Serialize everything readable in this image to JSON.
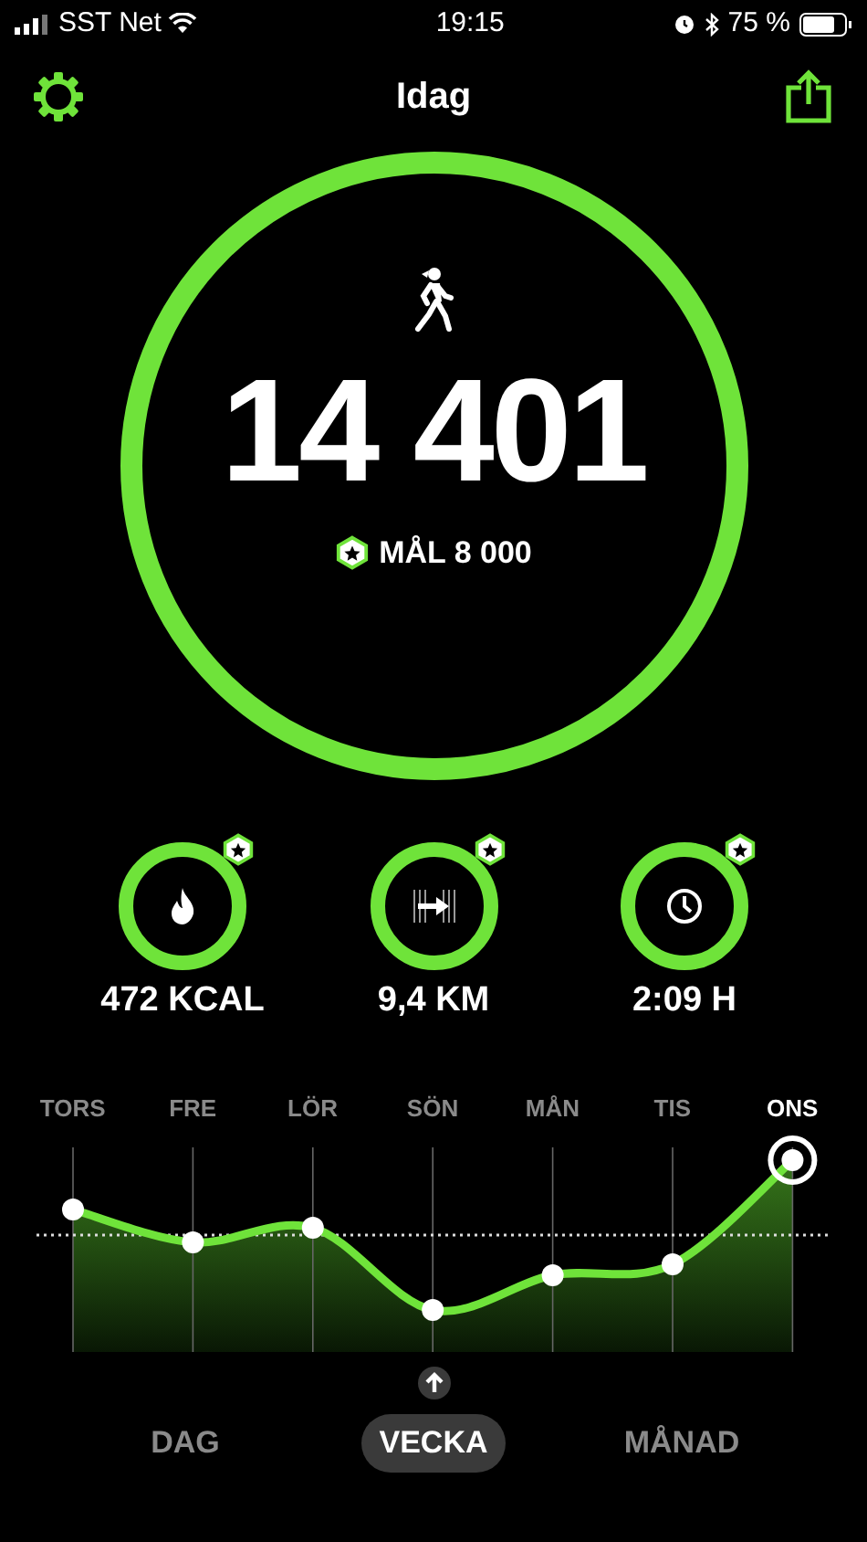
{
  "status_bar": {
    "carrier": "SST Net",
    "time": "19:15",
    "battery": "75 %"
  },
  "header": {
    "title": "Idag"
  },
  "steps": {
    "value": "14 401",
    "goal": "MÅL 8 000",
    "goal_reached": true
  },
  "metrics": [
    {
      "kind": "calories",
      "label": "472 KCAL",
      "goal_reached": true
    },
    {
      "kind": "distance",
      "label": "9,4 KM",
      "goal_reached": true
    },
    {
      "kind": "time",
      "label": "2:09 H",
      "goal_reached": true
    }
  ],
  "days": [
    {
      "label": "TORS",
      "selected": false
    },
    {
      "label": "FRE",
      "selected": false
    },
    {
      "label": "LÖR",
      "selected": false
    },
    {
      "label": "SÖN",
      "selected": false
    },
    {
      "label": "MÅN",
      "selected": false
    },
    {
      "label": "TIS",
      "selected": false
    },
    {
      "label": "ONS",
      "selected": true
    }
  ],
  "tabs": [
    {
      "label": "DAG",
      "selected": false
    },
    {
      "label": "VECKA",
      "selected": true
    },
    {
      "label": "MÅNAD",
      "selected": false
    }
  ]
}
